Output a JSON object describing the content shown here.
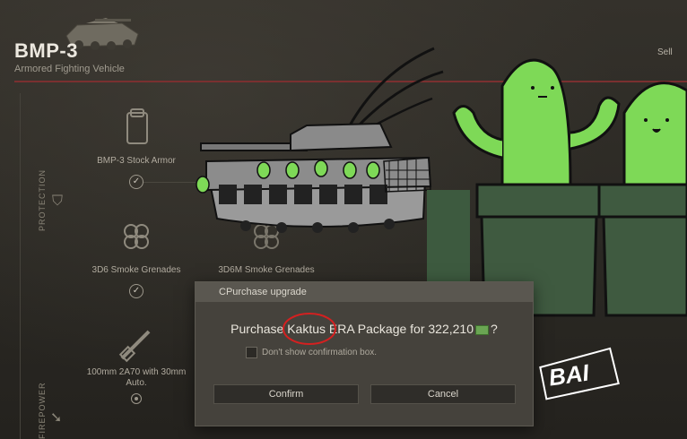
{
  "header": {
    "title": "BMP-3",
    "subtitle": "Armored Fighting Vehicle",
    "sell_label": "Sell"
  },
  "sections": [
    {
      "label": "PROTECTION",
      "icon": "shield-icon"
    },
    {
      "label": "FIREPOWER",
      "icon": "crosshair-icon"
    }
  ],
  "modules": [
    {
      "label": "BMP-3 Stock Armor",
      "icon": "armor-plate-icon",
      "owned": true
    },
    {
      "label": "3D6 Smoke Grenades",
      "icon": "smoke-grenade-icon",
      "owned": true
    },
    {
      "label": "3D6M Smoke Grenades",
      "icon": "smoke-grenade-icon",
      "owned": false
    },
    {
      "label": "100mm 2A70 with 30mm Auto.",
      "icon": "cannon-icon",
      "owned": true
    }
  ],
  "dialog": {
    "title": "CPurchase upgrade",
    "message_before": "Purchase Kaktus ERA Package for 322,210",
    "message_after": "?",
    "currency_icon": "money-icon",
    "dont_show_label": "Don't show confirmation box.",
    "dont_show_checked": false,
    "confirm_label": "Confirm",
    "cancel_label": "Cancel"
  },
  "overlay": {
    "watermark": "BAI"
  },
  "colors": {
    "accent_red": "#7a3030",
    "cactus_green": "#7ed957",
    "pot_green": "#3f5a40",
    "dialog_bg": "#45423c"
  }
}
